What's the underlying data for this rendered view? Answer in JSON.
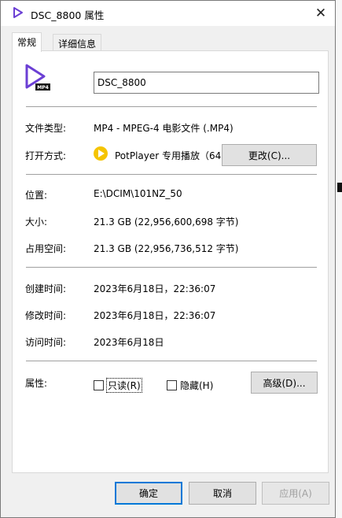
{
  "window": {
    "title": "DSC_8800 属性",
    "close_glyph": "✕"
  },
  "tabs": [
    {
      "label": "常规",
      "active": true
    },
    {
      "label": "详细信息",
      "active": false
    }
  ],
  "file_name": "DSC_8800",
  "file_icon": {
    "name": "video-file-icon",
    "badge": "MP4",
    "color": "#6b3fd4"
  },
  "fields": {
    "file_type": {
      "label": "文件类型:",
      "value": "MP4 - MPEG-4 电影文件 (.MP4)"
    },
    "open_with": {
      "label": "打开方式:",
      "app": "PotPlayer 专用播放（64",
      "change_button": "更改(C)..."
    },
    "location": {
      "label": "位置:",
      "value": "E:\\DCIM\\101NZ_50"
    },
    "size": {
      "label": "大小:",
      "value": "21.3 GB (22,956,600,698 字节)"
    },
    "size_on_disk": {
      "label": "占用空间:",
      "value": "21.3 GB (22,956,736,512 字节)"
    },
    "created": {
      "label": "创建时间:",
      "value": "2023年6月18日，22:36:07"
    },
    "modified": {
      "label": "修改时间:",
      "value": "2023年6月18日，22:36:07"
    },
    "accessed": {
      "label": "访问时间:",
      "value": "2023年6月18日"
    }
  },
  "attributes": {
    "label": "属性:",
    "readonly": {
      "label": "只读(R)",
      "checked": false
    },
    "hidden": {
      "label": "隐藏(H)",
      "checked": false
    },
    "advanced_button": "高级(D)..."
  },
  "buttons": {
    "ok": "确定",
    "cancel": "取消",
    "apply": "应用(A)"
  }
}
